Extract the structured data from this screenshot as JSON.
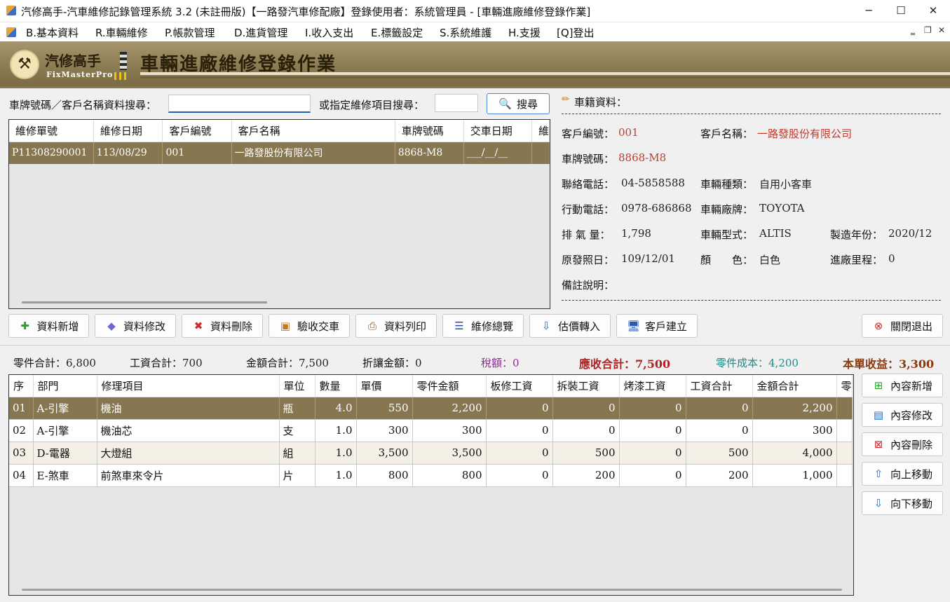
{
  "window": {
    "title": "汽修高手-汽車維修記錄管理系統 3.2 (未註冊版)【一路發汽車修配廠】登錄使用者：系統管理員 - [車輛進廠維修登錄作業]",
    "minimize": "─",
    "maximize": "☐",
    "close": "✕"
  },
  "menu": {
    "items": [
      "B.基本資料",
      "R.車輛維修",
      "P.帳款管理",
      "D.進貨管理",
      "I.收入支出",
      "E.標籤設定",
      "S.系統維護",
      "H.支援",
      "[Q]登出"
    ],
    "mdi_min": "‗",
    "mdi_restore": "❐",
    "mdi_close": "✕"
  },
  "banner": {
    "brand_cn": "汽修高手",
    "brand_en": "FixMasterPro",
    "title": "車輛進廠維修登錄作業"
  },
  "search": {
    "label_plate": "車牌號碼／客戶名稱資料搜尋：",
    "plate_value": "",
    "label_item": "或指定維修項目搜尋：",
    "item_value": "",
    "button": "搜尋"
  },
  "orders": {
    "columns": [
      "維修單號",
      "維修日期",
      "客戶編號",
      "客戶名稱",
      "車牌號碼",
      "交車日期",
      "維"
    ],
    "rows": [
      [
        "P11308290001",
        "113/08/29",
        "001",
        "一路發股份有限公司",
        "8868-M8",
        "___/__/__",
        ""
      ]
    ]
  },
  "vehicle": {
    "header": "車籍資料：",
    "customer_no_label": "客戶編號：",
    "customer_no": "001",
    "customer_name_label": "客戶名稱：",
    "customer_name": "一路發股份有限公司",
    "plate_label": "車牌號碼：",
    "plate": "8868-M8",
    "phone_label": "聯絡電話：",
    "phone": "04-5858588",
    "type_label": "車輛種類：",
    "type": "自用小客車",
    "mobile_label": "行動電話：",
    "mobile": "0978-686868",
    "brand_label": "車輛廠牌：",
    "brand": "TOYOTA",
    "cc_label": "排 氣 量：",
    "cc": "1,798",
    "model_label": "車輛型式：",
    "model": "ALTIS",
    "year_label": "製造年份：",
    "year": "2020/12",
    "reg_label": "原發照日：",
    "reg": "109/12/01",
    "color_label": "顏　　色：",
    "color": "白色",
    "mileage_label": "進廠里程：",
    "mileage": "0",
    "note_label": "備註說明：",
    "note": ""
  },
  "actions": {
    "add": "資料新增",
    "edit": "資料修改",
    "delete": "資料刪除",
    "accept": "驗收交車",
    "print": "資料列印",
    "overview": "維修總覽",
    "quote": "估價轉入",
    "customer": "客戶建立",
    "exit": "關閉退出"
  },
  "summary": {
    "parts_label": "零件合計：",
    "parts": "6,800",
    "labor_label": "工資合計：",
    "labor": "700",
    "amount_label": "金額合計：",
    "amount": "7,500",
    "discount_label": "折讓金額：",
    "discount": "0",
    "tax_label": "稅額：",
    "tax": "0",
    "receivable_label": "應收合計：",
    "receivable": "7,500",
    "cost_label": "零件成本：",
    "cost": "4,200",
    "profit_label": "本單收益：",
    "profit": "3,300"
  },
  "items": {
    "columns": [
      "序",
      "部門",
      "修理項目",
      "單位",
      "數量",
      "單價",
      "零件金額",
      "板修工資",
      "拆裝工資",
      "烤漆工資",
      "工資合計",
      "金額合計",
      "零"
    ],
    "rows": [
      [
        "01",
        "A-引擎",
        "機油",
        "瓶",
        "4.0",
        "550",
        "2,200",
        "0",
        "0",
        "0",
        "0",
        "2,200",
        ""
      ],
      [
        "02",
        "A-引擎",
        "機油芯",
        "支",
        "1.0",
        "300",
        "300",
        "0",
        "0",
        "0",
        "0",
        "300",
        ""
      ],
      [
        "03",
        "D-電器",
        "大燈組",
        "組",
        "1.0",
        "3,500",
        "3,500",
        "0",
        "500",
        "0",
        "500",
        "4,000",
        ""
      ],
      [
        "04",
        "E-煞車",
        "前煞車來令片",
        "片",
        "1.0",
        "800",
        "800",
        "0",
        "200",
        "0",
        "200",
        "1,000",
        ""
      ]
    ]
  },
  "item_actions": {
    "add": "內容新增",
    "edit": "內容修改",
    "delete": "內容刪除",
    "up": "向上移動",
    "down": "向下移動"
  },
  "colors": {
    "selected_row": "#867751",
    "banner": "#8b7c53",
    "highlight_red": "#c0392b",
    "tax_purple": "#8e2a8e",
    "cost_teal": "#1f8a8a",
    "profit_brown": "#8b3a0e"
  }
}
